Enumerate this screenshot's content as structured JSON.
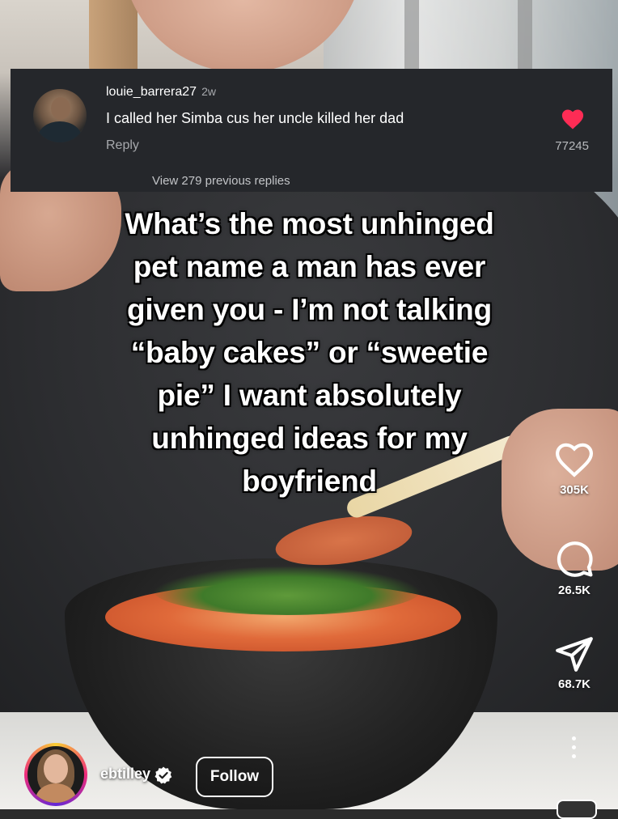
{
  "comment": {
    "username": "louie_barrera27",
    "age": "2w",
    "text": "I called her Simba cus her uncle killed her dad",
    "reply_label": "Reply",
    "likes": "77245",
    "view_more": "View 279 previous replies",
    "heart_color": "#fe2c55"
  },
  "caption": {
    "lines": [
      "What’s the most unhinged",
      "pet name a man has ever",
      "given you - I’m not talking",
      "“baby cakes” or “sweetie",
      "pie” I want absolutely",
      "unhinged ideas for my",
      "boyfriend"
    ]
  },
  "actions": {
    "likes": "305K",
    "comments": "26.5K",
    "shares": "68.7K"
  },
  "creator": {
    "username": "ebtilley",
    "follow_label": "Follow"
  }
}
